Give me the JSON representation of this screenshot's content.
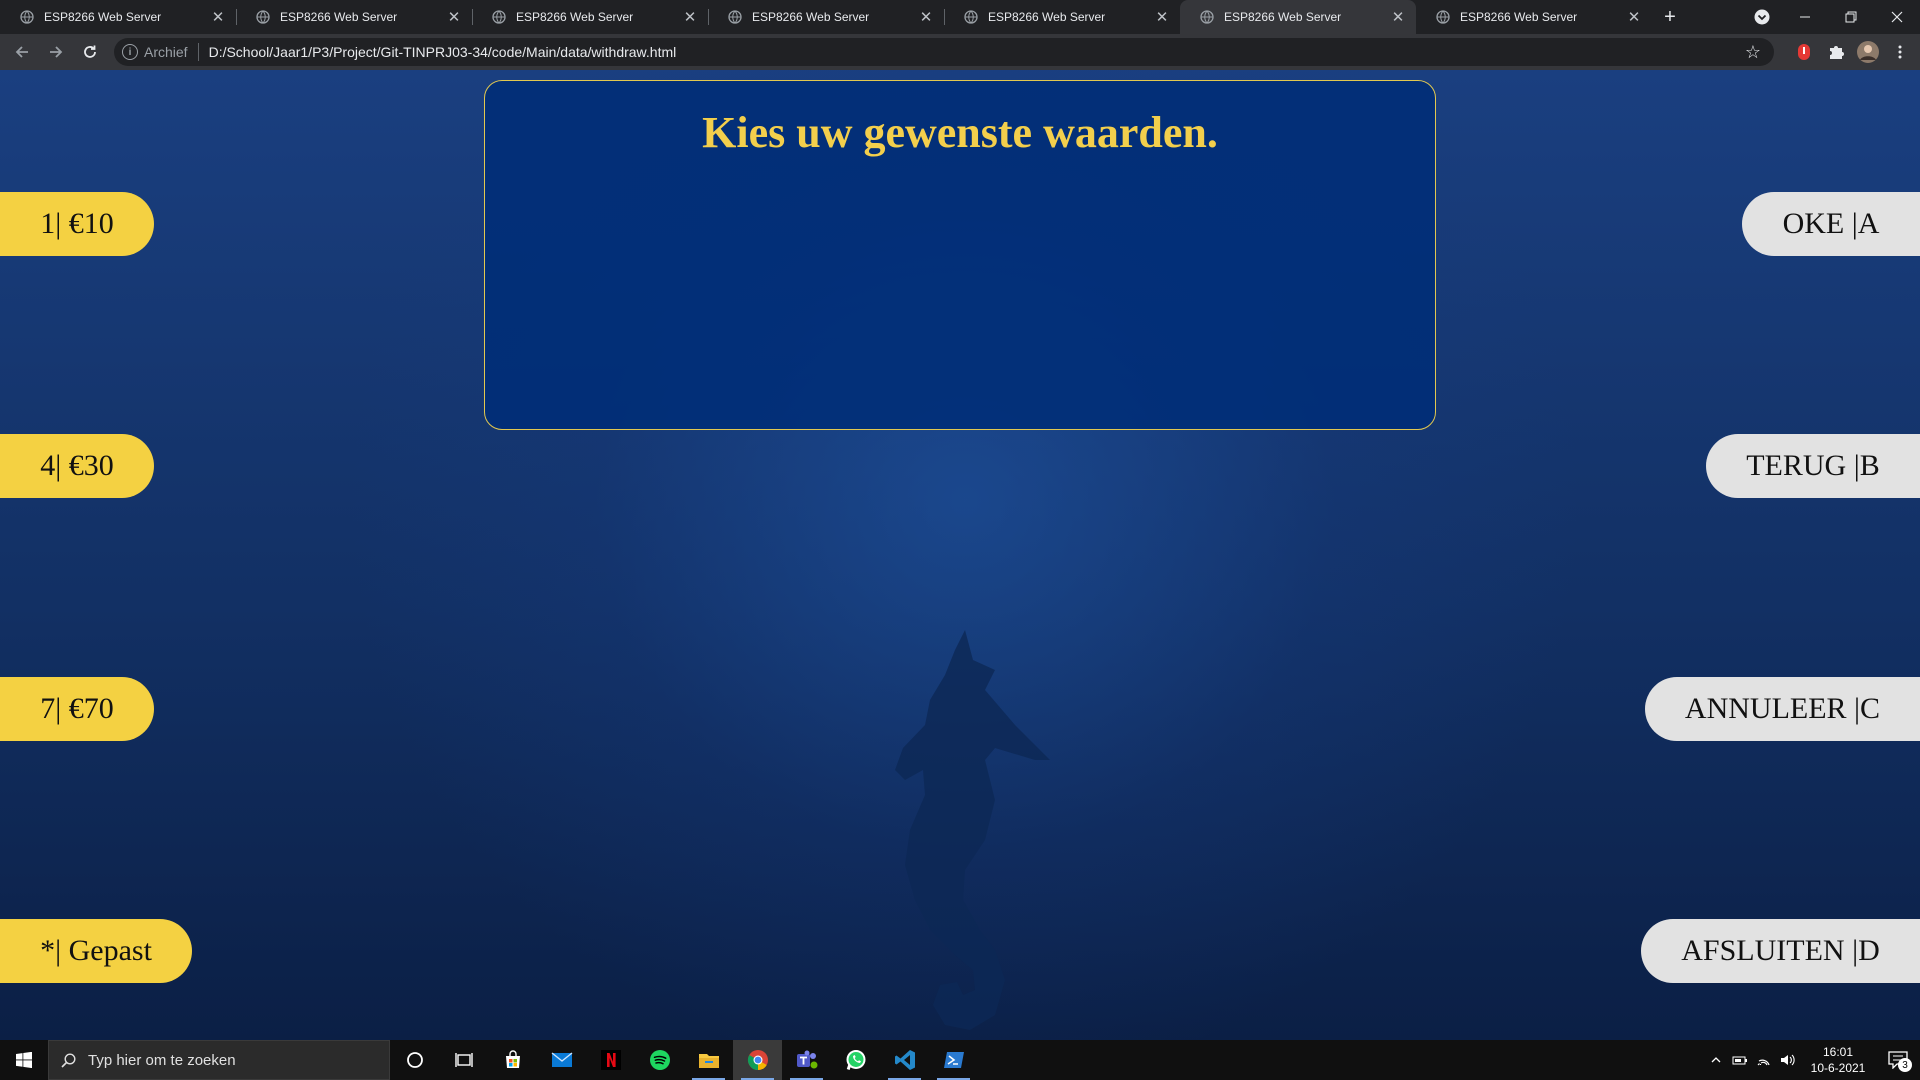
{
  "browser": {
    "tabs": [
      {
        "title": "ESP8266 Web Server",
        "active": false
      },
      {
        "title": "ESP8266 Web Server",
        "active": false
      },
      {
        "title": "ESP8266 Web Server",
        "active": false
      },
      {
        "title": "ESP8266 Web Server",
        "active": false
      },
      {
        "title": "ESP8266 Web Server",
        "active": false
      },
      {
        "title": "ESP8266 Web Server",
        "active": true
      },
      {
        "title": "ESP8266 Web Server",
        "active": false
      }
    ],
    "new_tab_label": "+",
    "address": {
      "security_label": "Archief",
      "url": "D:/School/Jaar1/P3/Project/Git-TINPRJ03-34/code/Main/data/withdraw.html"
    }
  },
  "page": {
    "display_title": "Kies uw gewenste waarden.",
    "left_keys": [
      {
        "label": "1| €10"
      },
      {
        "label": "4| €30"
      },
      {
        "label": "7| €70"
      },
      {
        "label": "*| Gepast"
      }
    ],
    "right_keys": [
      {
        "label": "OKE |A"
      },
      {
        "label": "TERUG |B"
      },
      {
        "label": "ANNULEER |C"
      },
      {
        "label": "AFSLUITEN |D"
      }
    ]
  },
  "taskbar": {
    "search_placeholder": "Typ hier om te zoeken",
    "pinned": [
      "cortana-icon",
      "task-view-icon",
      "store-icon",
      "mail-icon",
      "netflix-icon",
      "spotify-icon",
      "file-explorer-icon",
      "chrome-icon",
      "teams-icon",
      "whatsapp-icon",
      "vscode-icon",
      "powershell-icon"
    ],
    "clock_time": "16:01",
    "clock_date": "10-6-2021",
    "notification_count": "3"
  },
  "colors": {
    "key_yellow": "#f4d142",
    "key_grey": "#e2e2e2",
    "title_gold": "#f3cf4c",
    "panel_blue": "#002d78"
  }
}
